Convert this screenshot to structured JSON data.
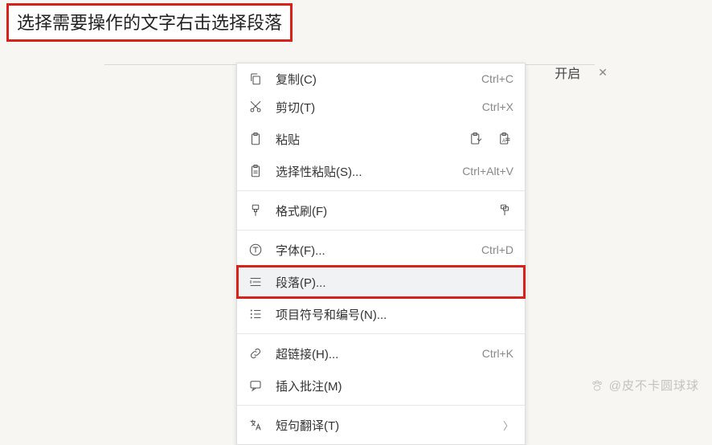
{
  "instruction": "选择需要操作的文字右击选择段落",
  "topbar": {
    "tab_fragment": "开启",
    "close_glyph": "✕"
  },
  "menu": {
    "items": [
      {
        "id": "copy",
        "label": "复制(C)",
        "shortcut": "Ctrl+C",
        "icon": "copy"
      },
      {
        "id": "cut",
        "label": "剪切(T)",
        "shortcut": "Ctrl+X",
        "icon": "cut"
      },
      {
        "id": "paste",
        "label": "粘贴",
        "icon": "paste",
        "trailing": [
          "paste-format",
          "paste-text"
        ]
      },
      {
        "id": "paste_special",
        "label": "选择性粘贴(S)...",
        "shortcut": "Ctrl+Alt+V",
        "icon": "paste-special"
      },
      {
        "sep": true
      },
      {
        "id": "format_painter",
        "label": "格式刷(F)",
        "icon": "format-painter",
        "trailing": [
          "format-painter-dual"
        ]
      },
      {
        "sep": true
      },
      {
        "id": "font",
        "label": "字体(F)...",
        "shortcut": "Ctrl+D",
        "icon": "font"
      },
      {
        "id": "paragraph",
        "label": "段落(P)...",
        "icon": "paragraph",
        "highlight": true,
        "frame": true
      },
      {
        "id": "bullets",
        "label": "项目符号和编号(N)...",
        "icon": "bullets"
      },
      {
        "sep": true
      },
      {
        "id": "hyperlink",
        "label": "超链接(H)...",
        "shortcut": "Ctrl+K",
        "icon": "link"
      },
      {
        "id": "comment",
        "label": "插入批注(M)",
        "icon": "comment"
      },
      {
        "sep": true
      },
      {
        "id": "translate",
        "label": "短句翻译(T)",
        "icon": "translate",
        "arrow": true
      }
    ]
  },
  "watermark": {
    "text": "@皮不卡圆球球"
  }
}
